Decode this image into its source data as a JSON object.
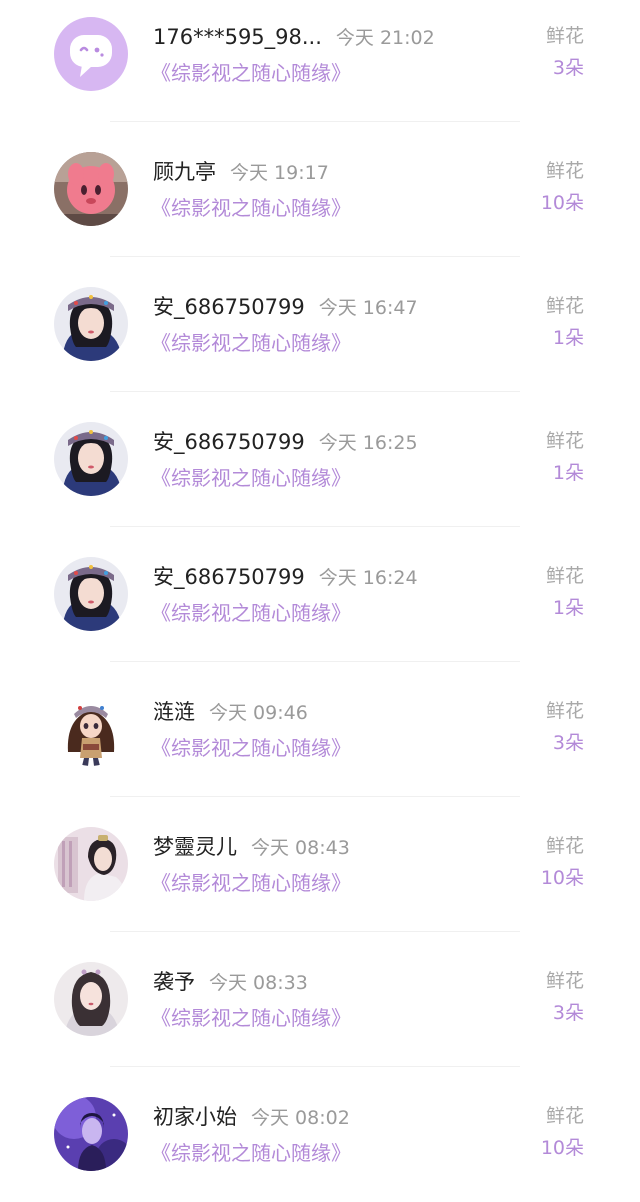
{
  "gift_list": {
    "items": [
      {
        "name": "176***595_98...",
        "time": "今天 21:02",
        "work": "《综影视之随心随缘》",
        "gift_label": "鲜花",
        "gift_count": "3朵",
        "avatar": "default-avatar-icon"
      },
      {
        "name": "顾九亭",
        "time": "今天 19:17",
        "work": "《综影视之随心随缘》",
        "gift_label": "鲜花",
        "gift_count": "10朵",
        "avatar": "pink-plush-photo"
      },
      {
        "name": "安_686750799",
        "time": "今天 16:47",
        "work": "《综影视之随心随缘》",
        "gift_label": "鲜花",
        "gift_count": "1朵",
        "avatar": "girl-portrait-photo"
      },
      {
        "name": "安_686750799",
        "time": "今天 16:25",
        "work": "《综影视之随心随缘》",
        "gift_label": "鲜花",
        "gift_count": "1朵",
        "avatar": "girl-portrait-photo"
      },
      {
        "name": "安_686750799",
        "time": "今天 16:24",
        "work": "《综影视之随心随缘》",
        "gift_label": "鲜花",
        "gift_count": "1朵",
        "avatar": "girl-portrait-photo"
      },
      {
        "name": "涟涟",
        "time": "今天 09:46",
        "work": "《综影视之随心随缘》",
        "gift_label": "鲜花",
        "gift_count": "3朵",
        "avatar": "cartoon-girl-photo"
      },
      {
        "name": "梦靈灵儿",
        "time": "今天 08:43",
        "work": "《综影视之随心随缘》",
        "gift_label": "鲜花",
        "gift_count": "10朵",
        "avatar": "costume-man-photo"
      },
      {
        "name": "袭予",
        "time": "今天 08:33",
        "work": "《综影视之随心随缘》",
        "gift_label": "鲜花",
        "gift_count": "3朵",
        "avatar": "ancient-woman-illustration"
      },
      {
        "name": "初家小始",
        "time": "今天 08:02",
        "work": "《综影视之随心随缘》",
        "gift_label": "鲜花",
        "gift_count": "10朵",
        "avatar": "purple-figure-illustration"
      }
    ]
  },
  "colors": {
    "accent": "#b38ad8",
    "name_text": "#222222",
    "secondary_text": "#9a9a9a"
  }
}
